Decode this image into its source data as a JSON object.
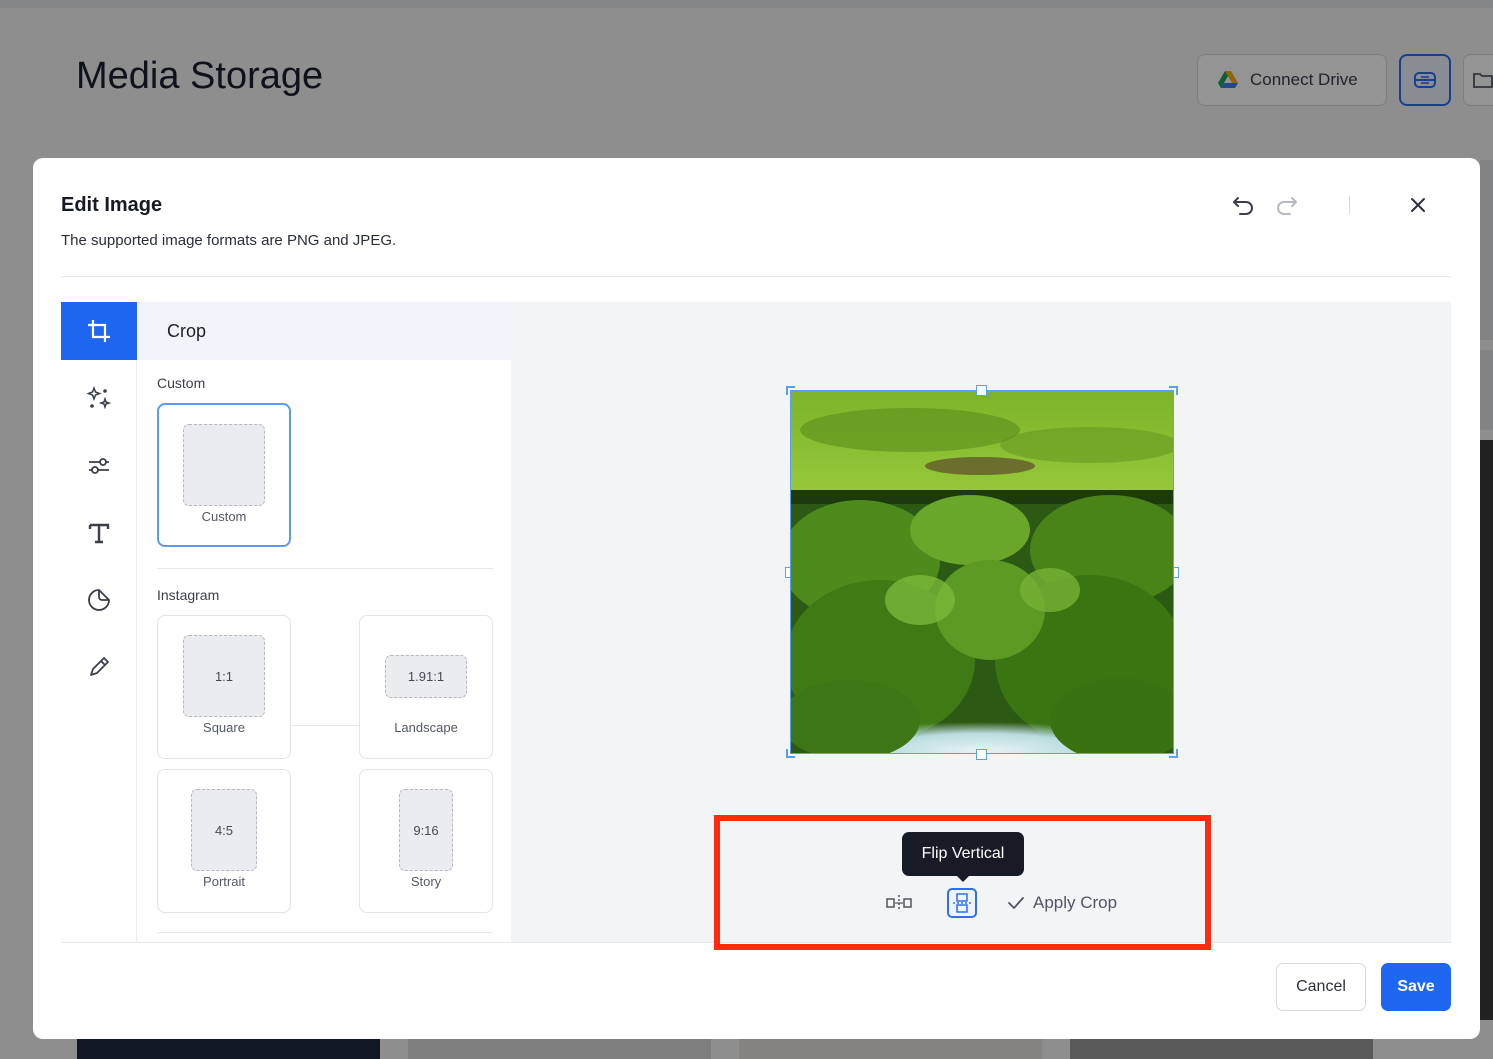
{
  "background": {
    "page_title": "Media Storage",
    "connect_drive_label": "Connect Drive",
    "icons": [
      "google-drive-icon",
      "media-view-icon",
      "folder-add-icon"
    ]
  },
  "modal": {
    "title": "Edit Image",
    "subtitle": "The supported image formats are PNG and JPEG.",
    "header_icons": [
      "undo-icon",
      "redo-icon",
      "close-icon"
    ],
    "tools": [
      "crop-icon",
      "magic-adjust-icon",
      "filters-icon",
      "text-icon",
      "sticker-icon",
      "draw-icon"
    ],
    "active_tool_label": "Crop",
    "custom_section": {
      "label": "Custom",
      "preset": {
        "caption": "Custom"
      }
    },
    "instagram_section": {
      "label": "Instagram",
      "presets": [
        {
          "ratio": "1:1",
          "caption": "Square"
        },
        {
          "ratio": "1.91:1",
          "caption": "Landscape"
        },
        {
          "ratio": "4:5",
          "caption": "Portrait"
        },
        {
          "ratio": "9:16",
          "caption": "Story"
        }
      ]
    },
    "canvas": {
      "tooltip": "Flip Vertical",
      "toolbar_icons": [
        "flip-horizontal-icon",
        "flip-vertical-icon",
        "check-icon"
      ],
      "apply_crop_label": "Apply Crop"
    },
    "footer": {
      "cancel_label": "Cancel",
      "save_label": "Save"
    }
  },
  "colors": {
    "accent": "#1f66f0",
    "highlight_box": "#ff2a12",
    "tooltip_bg": "#161b26"
  }
}
